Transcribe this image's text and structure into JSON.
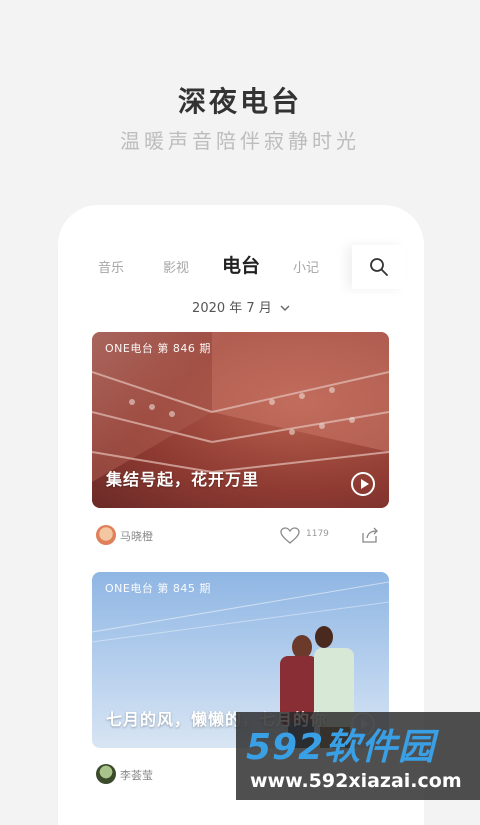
{
  "hero": {
    "title": "深夜电台",
    "subtitle": "温暖声音陪伴寂静时光"
  },
  "tabs": [
    {
      "label": "音乐",
      "active": false
    },
    {
      "label": "影视",
      "active": false
    },
    {
      "label": "电台",
      "active": true
    },
    {
      "label": "小记",
      "active": false
    }
  ],
  "search_icon": "search-icon",
  "date_selector": {
    "label": "2020 年 7 月",
    "icon": "chevron-down-icon"
  },
  "cards": [
    {
      "badge": "ONE电台 第 846 期",
      "title": "集结号起，花开万里",
      "author": "马晓橙",
      "likes": "1179"
    },
    {
      "badge": "ONE电台 第 845 期",
      "title": "七月的风，懒懒的，七月的你",
      "author": "李荟莹"
    }
  ],
  "watermark": {
    "brand": "592软件园",
    "url": "www.592xiazai.com"
  },
  "colors": {
    "background": "#f3f3f3",
    "accent": "#3aa0e6",
    "text_dark": "#222222"
  }
}
